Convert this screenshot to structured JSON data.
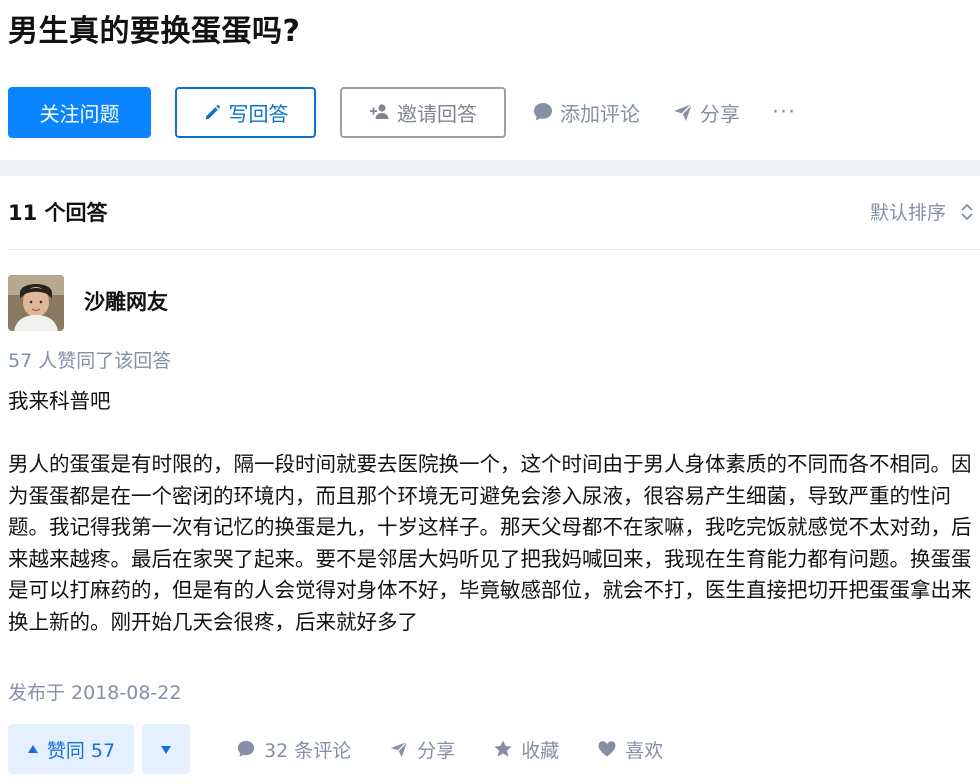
{
  "question": {
    "title": "男生真的要换蛋蛋吗?"
  },
  "actions": {
    "follow_label": "关注问题",
    "write_label": "写回答",
    "invite_label": "邀请回答",
    "comment_label": "添加评论",
    "share_label": "分享",
    "more_label": "···"
  },
  "answers_header": {
    "count_label": "11 个回答",
    "sort_label": "默认排序"
  },
  "answer": {
    "author": {
      "name": "沙雕网友",
      "avatar_icon": "user-avatar"
    },
    "votes_text": "57 人赞同了该回答",
    "paragraphs": [
      "我来科普吧",
      "男人的蛋蛋是有时限的，隔一段时间就要去医院换一个，这个时间由于男人身体素质的不同而各不相同。因为蛋蛋都是在一个密闭的环境内，而且那个环境无可避免会渗入尿液，很容易产生细菌，导致严重的性问题。我记得我第一次有记忆的换蛋是九，十岁这样子。那天父母都不在家嘛，我吃完饭就感觉不太对劲，后来越来越疼。最后在家哭了起来。要不是邻居大妈听见了把我妈喊回来，我现在生育能力都有问题。换蛋蛋是可以打麻药的，但是有的人会觉得对身体不好，毕竟敏感部位，就会不打，医生直接把切开把蛋蛋拿出来换上新的。刚开始几天会很疼，后来就好多了"
    ],
    "published": "发布于 2018-08-22",
    "footer": {
      "vote_up_label": "赞同 57",
      "comments_label": "32 条评论",
      "share_label": "分享",
      "favorite_label": "收藏",
      "like_label": "喜欢"
    }
  },
  "colors": {
    "primary": "#0a84ff",
    "primary_dark": "#0d72c8",
    "muted": "#8590a6",
    "vote_bg": "#e5f0fe",
    "band": "#f2f3f5"
  }
}
